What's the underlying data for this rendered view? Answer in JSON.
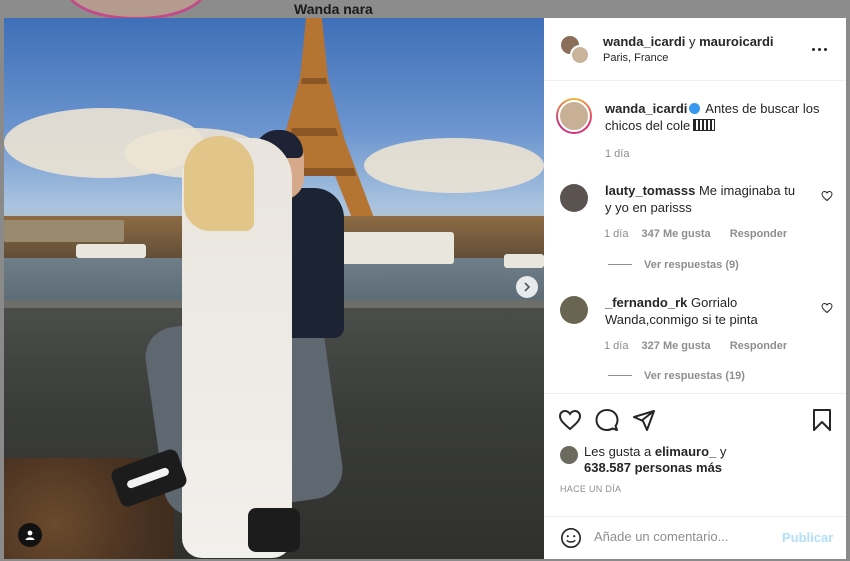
{
  "background": {
    "profile_name": "Wanda nara"
  },
  "post": {
    "header": {
      "user1": "wanda_icardi",
      "joiner": "y",
      "user2": "mauroicardi",
      "location": "Paris, France"
    },
    "caption": {
      "username": "wanda_icardi",
      "text": "Antes de buscar los chicos del cole",
      "time": "1 día"
    },
    "comments": [
      {
        "username": "lauty_tomasss",
        "text": "Me imaginaba tu y yo en parisss",
        "time": "1 día",
        "likes": "347 Me gusta",
        "reply": "Responder",
        "view_replies": "Ver respuestas (9)"
      },
      {
        "username": "_fernando_rk",
        "text": "Gorrialo Wanda,conmigo si te pinta",
        "time": "1 día",
        "likes": "327 Me gusta",
        "reply": "Responder",
        "view_replies": "Ver respuestas (19)"
      }
    ],
    "likes": {
      "prefix": "Les gusta a",
      "user": "elimauro_",
      "joiner": "y",
      "count": "638.587 personas más"
    },
    "date": "HACE UN DÍA",
    "add_comment": {
      "placeholder": "Añade un comentario...",
      "publish": "Publicar"
    }
  },
  "colors": {
    "link_disabled": "#b2dffc",
    "verified": "#3897f0",
    "muted": "#8e8e8e"
  }
}
